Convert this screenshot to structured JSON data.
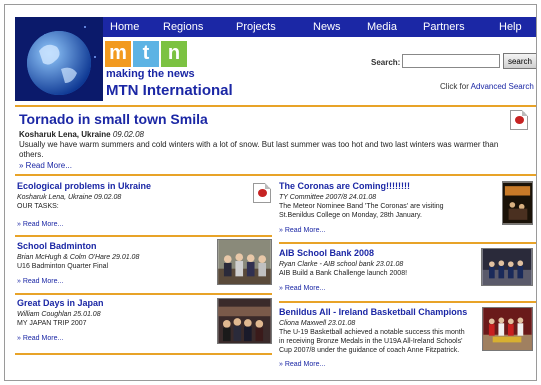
{
  "nav": {
    "items": [
      "Home",
      "Regions",
      "Projects",
      "News",
      "Media",
      "Partners",
      "Help"
    ]
  },
  "logo": {
    "letters": [
      "m",
      "t",
      "n"
    ],
    "colors": [
      "#f29a1f",
      "#5db3e4",
      "#7cc242"
    ]
  },
  "tagline": "making the news",
  "site_title": "MTN International",
  "search": {
    "label": "Search:",
    "value": "",
    "button_label": "search",
    "advanced_prefix": "Click for ",
    "advanced_link": "Advanced Search"
  },
  "lead": {
    "title": "Tornado in small town Smila",
    "author": "Kosharuk Lena, Ukraine",
    "date": "09.02.08",
    "text": "Usually we have warm summers and cold winters with a lot of snow. But last summer was too hot and two last winters was warmer than others.",
    "more": "» Read More..."
  },
  "left_stories": [
    {
      "title": "Ecological problems in Ukraine",
      "byline": "Kosharuk Lena, Ukraine  09.02.08",
      "text": "OUR TASKS:",
      "more": "» Read More...",
      "icon": "pdf-icon"
    },
    {
      "title": "School Badminton",
      "byline": "Brian McHugh & Colm O'Hare  29.01.08",
      "text": "U16 Badminton Quarter Final",
      "more": "» Read More..."
    },
    {
      "title": "Great Days in Japan",
      "byline": "William Coughlan  25.01.08",
      "text": "MY JAPAN TRIP 2007",
      "more": "» Read More..."
    }
  ],
  "right_stories": [
    {
      "title": "The Coronas are Coming!!!!!!!!",
      "byline": "TY Committee 2007/8  24.01.08",
      "text": "The Meteor Nominee Band 'The Coronas' are visiting St.Benildus College on Monday, 28th January.",
      "more": "» Read More...",
      "icon": "pdf-icon"
    },
    {
      "title": "AIB School Bank 2008",
      "byline": "Ryan Clarke - AIB school bank  23.01.08",
      "text": "AIB Build a Bank Challenge launch 2008!",
      "more": "» Read More..."
    },
    {
      "title": "Benildus All - Ireland Basketball Champions",
      "byline": "Cliona Maxwell  23.01.08",
      "text": "The U-19 Basketball achieved a notable success this month in receiving Bronze Medals in the U19A All-Ireland Schools' Cup 2007/8 under the guidance of coach Anne Fitzpatrick.",
      "more": "» Read More..."
    }
  ]
}
